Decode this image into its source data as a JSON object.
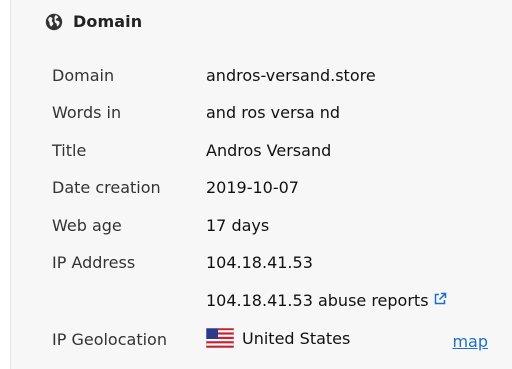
{
  "section": {
    "title": "Domain",
    "icon": "globe-icon"
  },
  "rows": [
    {
      "label": "Domain",
      "value": "andros-versand.store"
    },
    {
      "label": "Words in",
      "value": "and ros versa nd"
    },
    {
      "label": "Title",
      "value": "Andros Versand"
    },
    {
      "label": "Date creation",
      "value": "2019-10-07"
    },
    {
      "label": "Web age",
      "value": "17 days"
    },
    {
      "label": "IP Address",
      "value": "104.18.41.53"
    }
  ],
  "abuse": {
    "text": "104.18.41.53 abuse reports",
    "icon": "external-link-icon"
  },
  "geolocation": {
    "label": "IP Geolocation",
    "country": "United States",
    "flag_icon": "us-flag-icon",
    "map_label": "map"
  },
  "colors": {
    "link": "#1f6fc5",
    "background": "#f7f7f7"
  }
}
